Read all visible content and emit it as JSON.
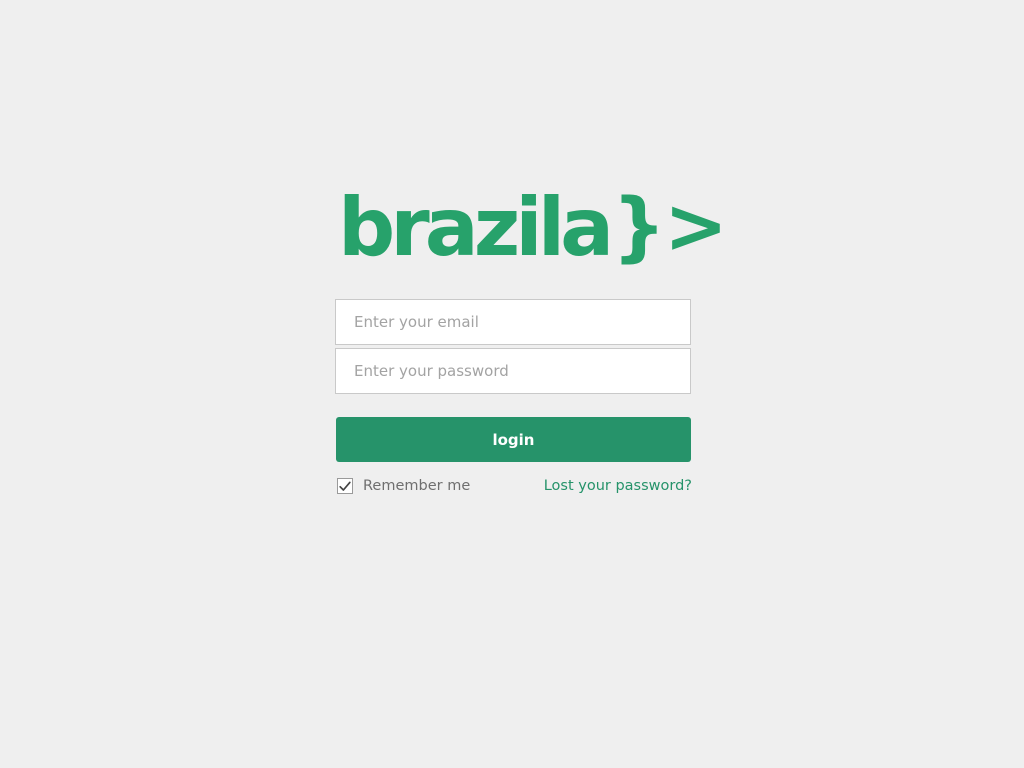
{
  "brand": {
    "name": "brazila",
    "mark": "}>"
  },
  "login_form": {
    "email": {
      "value": "",
      "placeholder": "Enter your email"
    },
    "password": {
      "value": "",
      "placeholder": "Enter your password"
    },
    "submit_label": "login",
    "remember_me": {
      "label": "Remember me",
      "checked": true
    },
    "lost_password_label": "Lost your password?"
  },
  "colors": {
    "background": "#efefef",
    "brand_green": "#27a26b",
    "button_green": "#26936a",
    "link_green": "#26936a"
  },
  "icons": {
    "checkbox_mark": "checkmark-icon"
  }
}
